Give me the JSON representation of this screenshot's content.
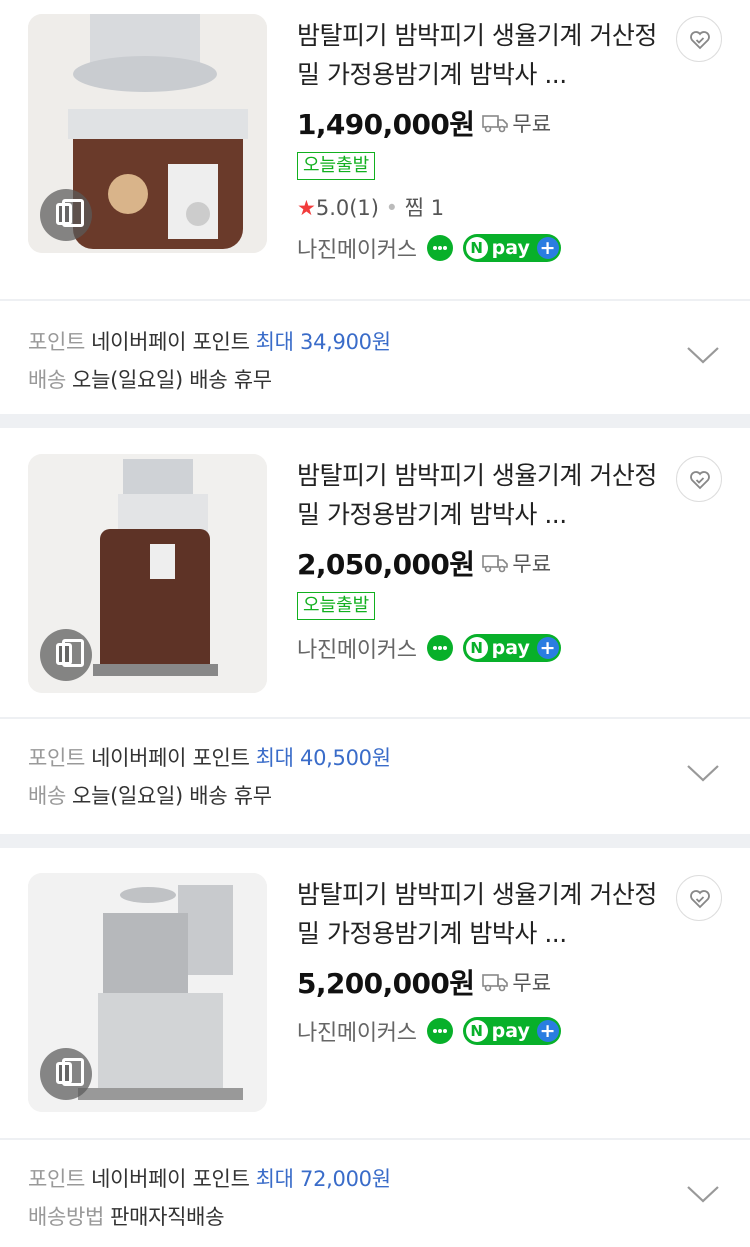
{
  "products": [
    {
      "title": "밤탈피기 밤박피기 생율기계 거산정밀 가정용밤기계 밤박사 ...",
      "price": "1,490,000원",
      "shipping": "무료",
      "badge": "오늘출발",
      "rating_star": "★",
      "rating": "5.0",
      "review_count": "(1)",
      "zzim": "찜 1",
      "seller": "나진메이커스",
      "npay_label": "pay",
      "point_label": "포인트",
      "point_text": "네이버페이 포인트",
      "point_max": "최대 34,900원",
      "delivery_label": "배송",
      "delivery_text": "오늘(일요일) 배송 휴무"
    },
    {
      "title": "밤탈피기 밤박피기 생율기계 거산정밀 가정용밤기계 밤박사 ...",
      "price": "2,050,000원",
      "shipping": "무료",
      "badge": "오늘출발",
      "seller": "나진메이커스",
      "npay_label": "pay",
      "point_label": "포인트",
      "point_text": "네이버페이 포인트",
      "point_max": "최대 40,500원",
      "delivery_label": "배송",
      "delivery_text": "오늘(일요일) 배송 휴무"
    },
    {
      "title": "밤탈피기 밤박피기 생율기계 거산정밀 가정용밤기계 밤박사 ...",
      "price": "5,200,000원",
      "shipping": "무료",
      "seller": "나진메이커스",
      "npay_label": "pay",
      "point_label": "포인트",
      "point_text": "네이버페이 포인트",
      "point_max": "최대 72,000원",
      "delivery_label": "배송방법",
      "delivery_text": "판매자직배송"
    }
  ],
  "colors": {
    "green": "#12b01f",
    "point_blue": "#3a6cc9",
    "divider": "#eef0f3",
    "star": "#f23c3c"
  },
  "icons": {
    "copy": "copy-icon",
    "truck": "truck-icon",
    "heart": "heart-check-icon",
    "talk": "talk-icon",
    "chevron": "chevron-down-icon"
  }
}
